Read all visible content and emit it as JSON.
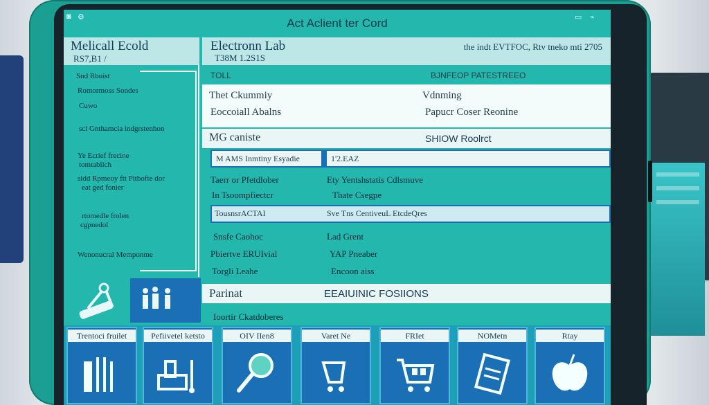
{
  "window": {
    "title": "Act Aclient ter Cord"
  },
  "left_header": {
    "title": "Melicall Ecold",
    "sub": "RS7,B1 /"
  },
  "left_list": {
    "items": [
      "Snd Rbuist",
      "Romormoss Sondes",
      "Cuwo",
      "scl Gnthamcia indgrstenhon",
      "Ye Ecrief frecine",
      "tomtablich",
      "sidd Rpmeoy ftt Pitbofte dor",
      "eat ged fonier",
      "rtomedle frolen",
      "cgpnedol",
      "Wenonucral Memponme"
    ]
  },
  "main_header": {
    "title": "Electronn Lab",
    "sub": "T38M 1.2S1S",
    "right": "the indt  EVTFOC, Rtv tneko mti 2705"
  },
  "row_headers": {
    "left": "TOLL",
    "right": "BJNFEOP PATESTREEO"
  },
  "info": {
    "l1": "Thet Ckummiy",
    "l2": "Eoccoiall Abalns",
    "r1": "Vdnming",
    "r2": "Papucr Coser Reonine"
  },
  "mg": {
    "left": "MG caniste",
    "right": "SHIOW Roolrct"
  },
  "blue_row": {
    "left": "M AMS Inmtiny Esyadie",
    "right": "1'2.EAZ"
  },
  "details": {
    "l1": "Taerr or Pfetdlober",
    "l2": "In Tsoompfiectcr",
    "r1": "Ety Yentshstatis Cdlsmuve",
    "r2": "Thate Csegpe"
  },
  "section_bar": {
    "left": "TousnsrACTAI",
    "right": "Sve Tns CentiveuL EtcdeQres"
  },
  "details2": {
    "l1": "Snsfe Caohoc",
    "l2": "Pbiertve ERUIvial",
    "l3": "Torgli Leahe",
    "r1": "Lad Grent",
    "r2": "YAP Pneaber",
    "r3": "Encoon aiss"
  },
  "patient_bar": {
    "left": "Parinat",
    "right": "EEAIUINIC FOSIIONS"
  },
  "footer_caption": "Ioortir Ckatdoberes",
  "toolbar": [
    {
      "label": "Trentoci fruilet",
      "icon": "test-tubes-icon"
    },
    {
      "label": "Pefiivetel ketsto",
      "icon": "scanner-icon"
    },
    {
      "label": "OIV IIen8",
      "icon": "magnifier-icon"
    },
    {
      "label": "Varet Ne",
      "icon": "cart-icon"
    },
    {
      "label": "FRIet",
      "icon": "shopping-cart-icon"
    },
    {
      "label": "NOMetn",
      "icon": "document-icon"
    },
    {
      "label": "Rtay",
      "icon": "apple-icon"
    }
  ],
  "colors": {
    "screen": "#23b7ad",
    "accent_blue": "#1b6fb4",
    "panel": "#eaf6f6",
    "tablet_case": "#1b9f92"
  }
}
